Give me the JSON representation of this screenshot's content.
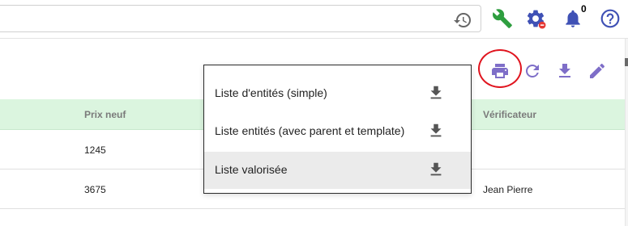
{
  "topbar": {
    "search": {
      "value": "",
      "placeholder": ""
    },
    "notification_count": "0",
    "icons": {
      "history": "history-icon",
      "wrench": "wrench-icon",
      "settings": "gear-icon",
      "notifications": "bell-icon",
      "help": "help-icon"
    },
    "colors": {
      "wrench": "#2e9e3f",
      "primary": "#3f51b5",
      "alert": "#e53935"
    }
  },
  "toolbar": {
    "icons": [
      "print-icon",
      "refresh-icon",
      "download-icon",
      "edit-icon"
    ],
    "icon_color": "#7e6ec8",
    "highlight_color": "#e0141e"
  },
  "table": {
    "headers": {
      "prix_neuf": "Prix neuf",
      "verificateur": "Vérificateur"
    },
    "rows": [
      {
        "prix_neuf": "1245",
        "verificateur": ""
      },
      {
        "prix_neuf": "3675",
        "verificateur": "Jean Pierre"
      }
    ],
    "header_bg": "#dbf5df"
  },
  "menu": {
    "items": [
      {
        "label": "Liste d'entités (simple)"
      },
      {
        "label": "Liste entités (avec parent et template)"
      },
      {
        "label": "Liste valorisée"
      }
    ],
    "selected_index": 2
  }
}
